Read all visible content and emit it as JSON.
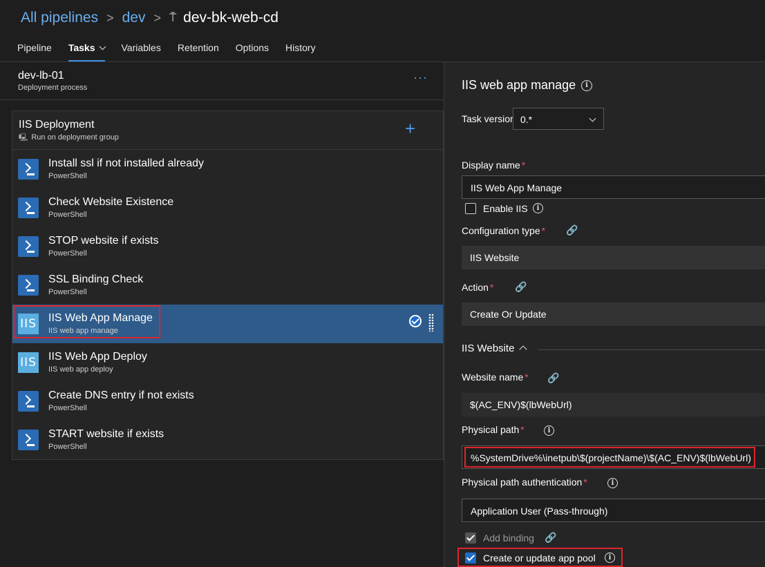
{
  "breadcrumb": {
    "all_pipelines": "All pipelines",
    "folder": "dev",
    "pipeline": "dev-bk-web-cd",
    "pipeline_icon": "release-pipeline-icon"
  },
  "tabs": [
    {
      "label": "Pipeline"
    },
    {
      "label": "Tasks",
      "active": true
    },
    {
      "label": "Variables"
    },
    {
      "label": "Retention"
    },
    {
      "label": "Options"
    },
    {
      "label": "History"
    }
  ],
  "stage": {
    "title": "dev-lb-01",
    "subtitle": "Deployment process",
    "menu": "···"
  },
  "job": {
    "title": "IIS Deployment",
    "subtitle": "Run on deployment group",
    "add": "+"
  },
  "tasks": [
    {
      "name": "Install ssl if not installed already",
      "type": "PowerShell",
      "icon": "powershell-icon"
    },
    {
      "name": "Check Website Existence",
      "type": "PowerShell",
      "icon": "powershell-icon"
    },
    {
      "name": "STOP website if exists",
      "type": "PowerShell",
      "icon": "powershell-icon"
    },
    {
      "name": "SSL Binding Check",
      "type": "PowerShell",
      "icon": "powershell-icon"
    },
    {
      "name": "IIS Web App Manage",
      "type": "IIS web app manage",
      "icon": "iis-icon",
      "selected": true
    },
    {
      "name": "IIS Web App Deploy",
      "type": "IIS web app deploy",
      "icon": "iis-icon"
    },
    {
      "name": "Create DNS entry if not exists",
      "type": "PowerShell",
      "icon": "powershell-icon"
    },
    {
      "name": "START website if exists",
      "type": "PowerShell",
      "icon": "powershell-icon"
    }
  ],
  "iis_icon_text": "IIS",
  "panel": {
    "title": "IIS web app manage",
    "task_version_label": "Task version",
    "task_version_value": "0.*",
    "display_name_label": "Display name",
    "display_name_value": "IIS Web App Manage",
    "enable_iis_label": "Enable IIS",
    "enable_iis_checked": false,
    "config_type_label": "Configuration type",
    "config_type_value": "IIS Website",
    "action_label": "Action",
    "action_value": "Create Or Update",
    "section_title": "IIS Website",
    "website_name_label": "Website name",
    "website_name_value": "$(AC_ENV)$(lbWebUrl)",
    "physical_path_label": "Physical path",
    "physical_path_value": "%SystemDrive%\\inetpub\\$(projectName)\\$(AC_ENV)$(lbWebUrl)",
    "physical_path_auth_label": "Physical path authentication",
    "physical_path_auth_value": "Application User (Pass-through)",
    "add_binding_label": "Add binding",
    "add_binding_checked": true,
    "app_pool_label": "Create or update app pool",
    "app_pool_checked": true,
    "required_mark": "*",
    "info_glyph": "i",
    "link_glyph": "🔗"
  },
  "colors": {
    "accent": "#3f8fe0",
    "selected_row": "#2f5b8a",
    "highlight_box": "#e0242b",
    "powershell_icon": "#2b6cb5",
    "iis_icon": "#5aaee0"
  }
}
